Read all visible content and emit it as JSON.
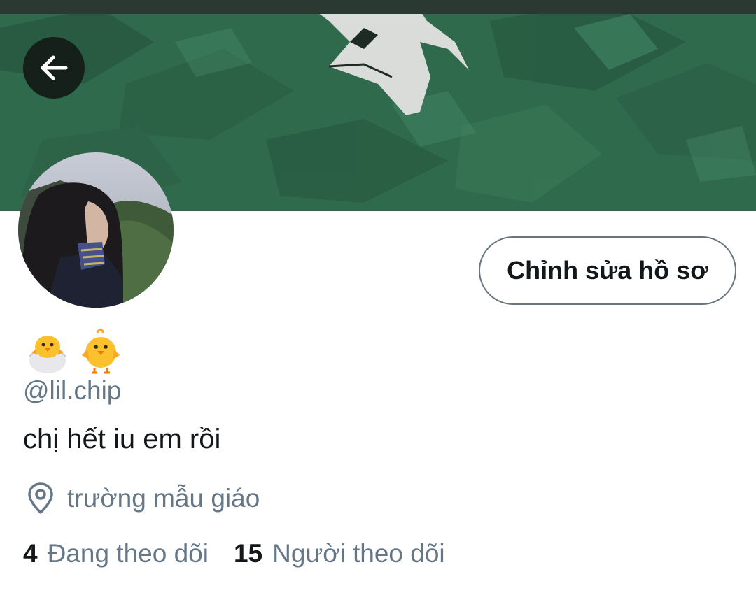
{
  "profile": {
    "display_name_icons": [
      "hatching-chick-icon",
      "baby-chick-icon"
    ],
    "handle": "@lil.chip",
    "bio": "chị hết iu em rồi",
    "location": "trường mẫu giáo",
    "edit_button": "Chỉnh sửa hồ sơ"
  },
  "stats": {
    "following_count": "4",
    "following_label": "Đang theo dõi",
    "followers_count": "15",
    "followers_label": "Người theo dõi"
  },
  "icons": {
    "back": "arrow-left-icon",
    "location": "location-pin-icon"
  },
  "colors": {
    "banner_green": "#2f6b4c",
    "text_primary": "#14171a",
    "text_secondary": "#657786",
    "button_border": "#66757f"
  }
}
